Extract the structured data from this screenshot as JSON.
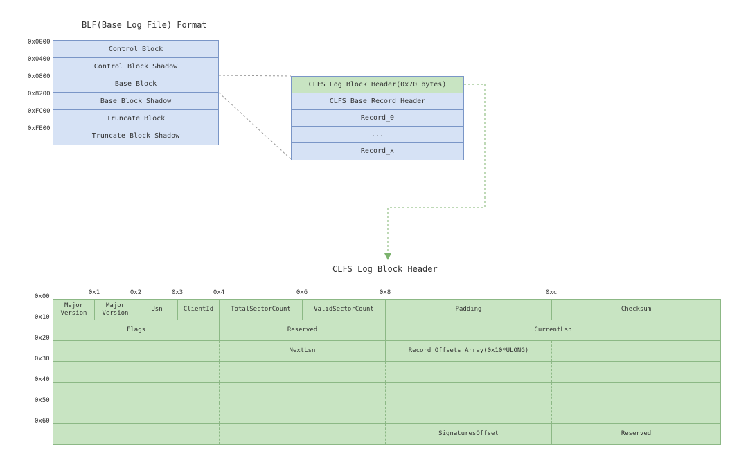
{
  "titles": {
    "blf": "BLF(Base Log File) Format",
    "header": "CLFS Log Block Header"
  },
  "blf_offsets": [
    "0x0000",
    "0x0400",
    "0x0800",
    "0x8200",
    "0xFC00",
    "0xFE00"
  ],
  "blf_rows": [
    "Control Block",
    "Control Block Shadow",
    "Base Block",
    "Base Block Shadow",
    "Truncate Block",
    "Truncate Block Shadow"
  ],
  "detail_rows": [
    "CLFS Log Block Header(0x70 bytes)",
    "CLFS Base Record Header",
    "Record_0",
    "...",
    "Record_x"
  ],
  "header_ticks": [
    "0x1",
    "0x2",
    "0x3",
    "0x4",
    "0x6",
    "0x8",
    "0xc"
  ],
  "row_offsets": [
    "0x00",
    "0x10",
    "0x20",
    "0x30",
    "0x40",
    "0x50",
    "0x60"
  ],
  "row0": [
    "Major\nVersion",
    "Major\nVersion",
    "Usn",
    "ClientId",
    "TotalSectorCount",
    "ValidSectorCount",
    "Padding",
    "Checksum"
  ],
  "row1": [
    "Flags",
    "Reserved",
    "CurrentLsn"
  ],
  "row2": [
    "NextLsn",
    "Record Offsets Array(0x10*ULONG)"
  ],
  "row6": [
    "SignaturesOffset",
    "Reserved"
  ]
}
